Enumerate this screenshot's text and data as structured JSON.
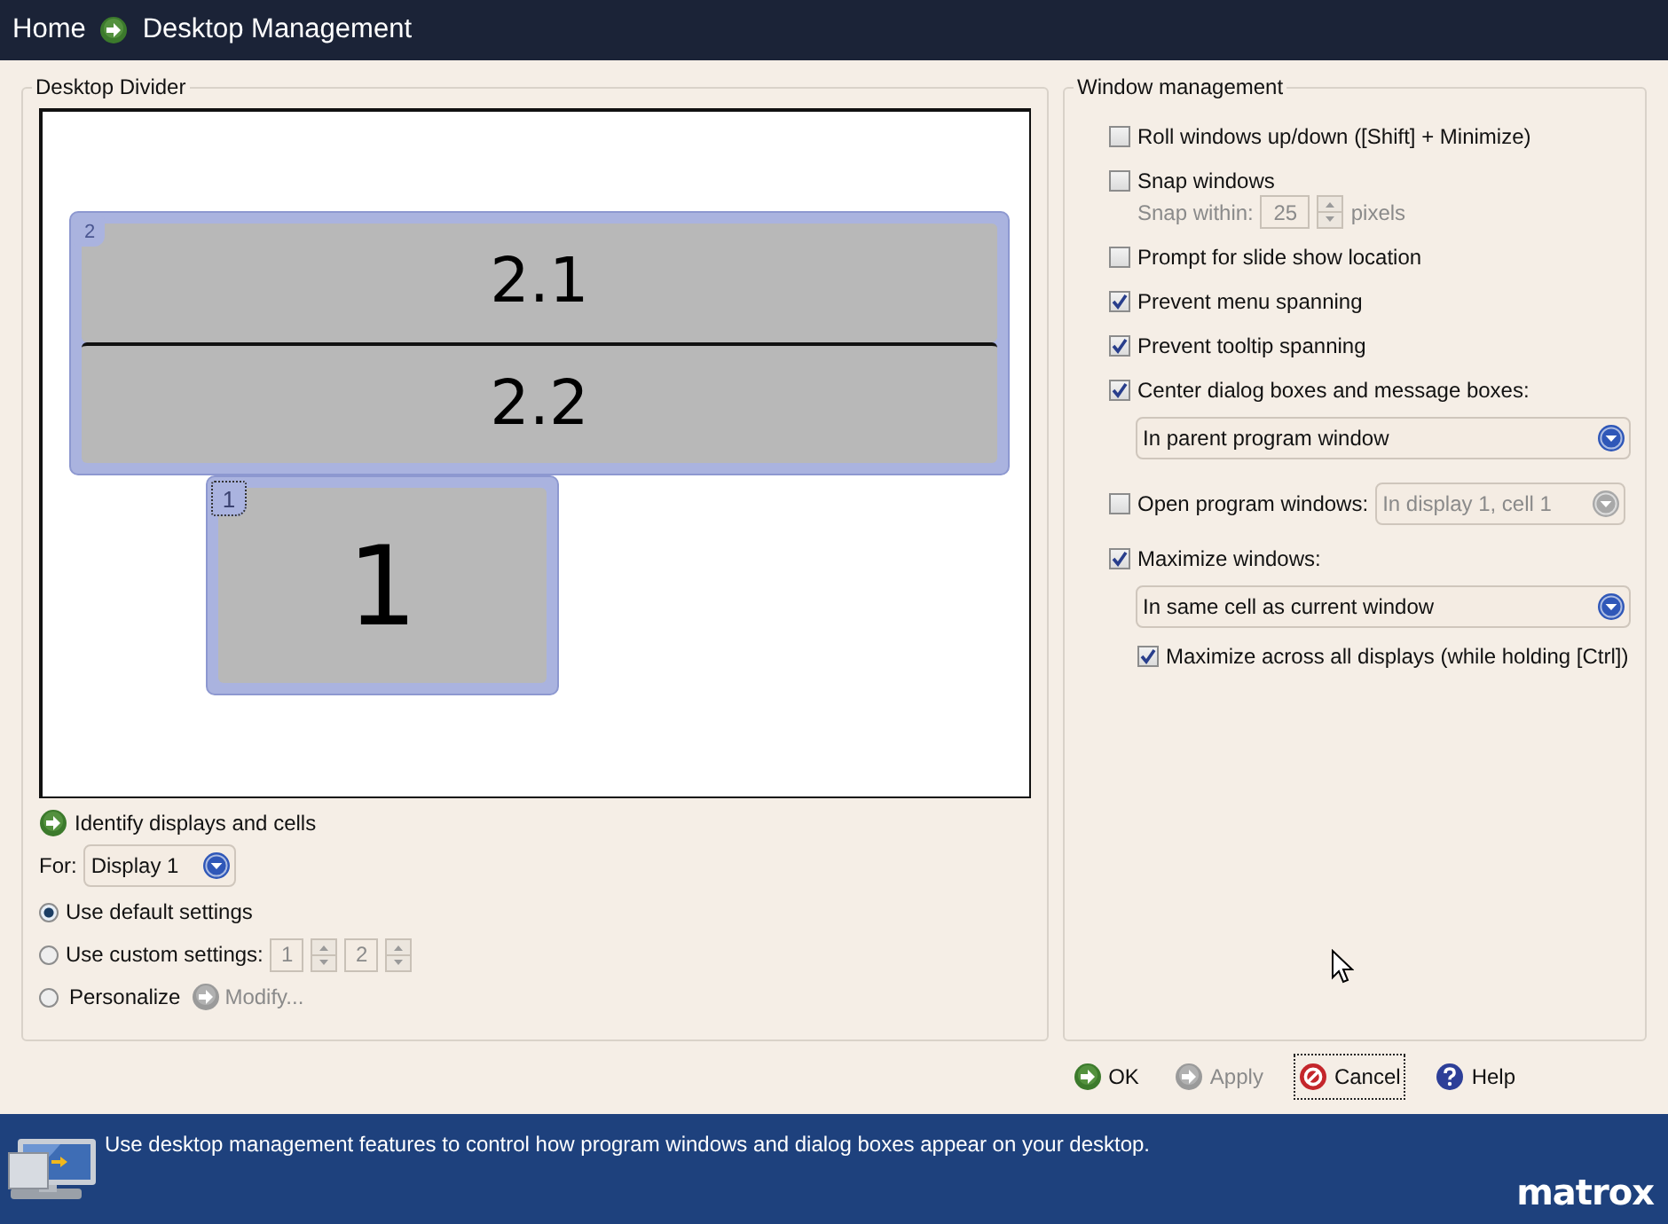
{
  "header": {
    "breadcrumb": [
      {
        "label": "Home"
      },
      {
        "label": "Desktop Management"
      }
    ]
  },
  "desktop_divider": {
    "title": "Desktop Divider",
    "displays": [
      {
        "number": "2",
        "selected": false,
        "cells": [
          "2.1",
          "2.2"
        ]
      },
      {
        "number": "1",
        "selected": true,
        "cells": [
          "1"
        ]
      }
    ],
    "identify_link": "Identify displays and cells",
    "for_label": "For:",
    "for_value": "Display 1",
    "options": [
      {
        "kind": "plain",
        "label": "Use default settings",
        "selected": true
      },
      {
        "kind": "spinners",
        "label": "Use custom settings:",
        "selected": false,
        "spinners": [
          "1",
          "2"
        ]
      },
      {
        "kind": "action",
        "label": "Personalize",
        "selected": false,
        "action": "Modify..."
      }
    ]
  },
  "window_management": {
    "title": "Window management",
    "rows": [
      {
        "kind": "checkbox",
        "label": "Roll windows up/down ([Shift] + Minimize)",
        "checked": false
      },
      {
        "kind": "checkbox",
        "label": "Snap windows",
        "checked": false
      },
      {
        "kind": "spin",
        "label": "Snap within:",
        "value": "25",
        "unit": "pixels",
        "disabled": true
      },
      {
        "kind": "checkbox",
        "label": "Prompt for slide show location",
        "checked": false
      },
      {
        "kind": "checkbox",
        "label": "Prevent menu spanning",
        "checked": true
      },
      {
        "kind": "checkbox",
        "label": "Prevent tooltip spanning",
        "checked": true
      },
      {
        "kind": "checkbox",
        "label": "Center dialog boxes and message boxes:",
        "checked": true
      },
      {
        "kind": "dropdown",
        "value": "In parent program window",
        "disabled": false
      },
      {
        "kind": "checkbox-dropdown",
        "label": "Open program windows:",
        "checked": false,
        "value": "In display 1, cell 1",
        "disabled": true
      },
      {
        "kind": "checkbox",
        "label": "Maximize windows:",
        "checked": true
      },
      {
        "kind": "dropdown",
        "value": "In same cell as current window",
        "disabled": false
      },
      {
        "kind": "sub-checkbox",
        "label": "Maximize across all displays (while holding [Ctrl])",
        "checked": true
      }
    ]
  },
  "buttons": [
    {
      "kind": "ok",
      "label": "OK",
      "disabled": false,
      "focused": false
    },
    {
      "kind": "apply",
      "label": "Apply",
      "disabled": true,
      "focused": false
    },
    {
      "kind": "cancel",
      "label": "Cancel",
      "disabled": false,
      "focused": true
    },
    {
      "kind": "help",
      "label": "Help",
      "disabled": false,
      "focused": false
    }
  ],
  "footer": {
    "message": "Use desktop management features to control how program windows and dialog boxes appear on your desktop.",
    "logo": "matrox"
  }
}
